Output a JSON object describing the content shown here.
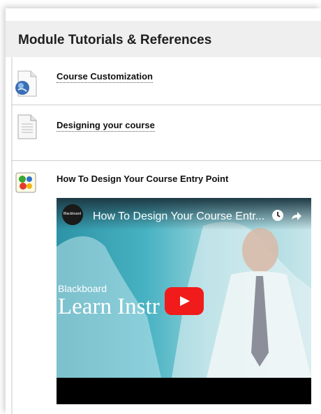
{
  "module": {
    "title": "Module Tutorials & References"
  },
  "items": [
    {
      "label": "Course Customization",
      "icon": "web-link-globe-icon"
    },
    {
      "label": "Designing your course",
      "icon": "document-icon"
    },
    {
      "label": "How To Design Your Course Entry Point",
      "icon": "mashup-puzzle-icon"
    }
  ],
  "video": {
    "title": "How To Design Your Course Entr...",
    "channel": "Blackboard",
    "overlay_brand": "Blackboard",
    "overlay_text": "Learn Instr  or",
    "controls": [
      "watch-later-icon",
      "share-icon",
      "play-button"
    ]
  },
  "colors": {
    "header_bg": "#efefef",
    "play_red": "#f11b1b",
    "thumb_teal": "#47b2c2"
  }
}
